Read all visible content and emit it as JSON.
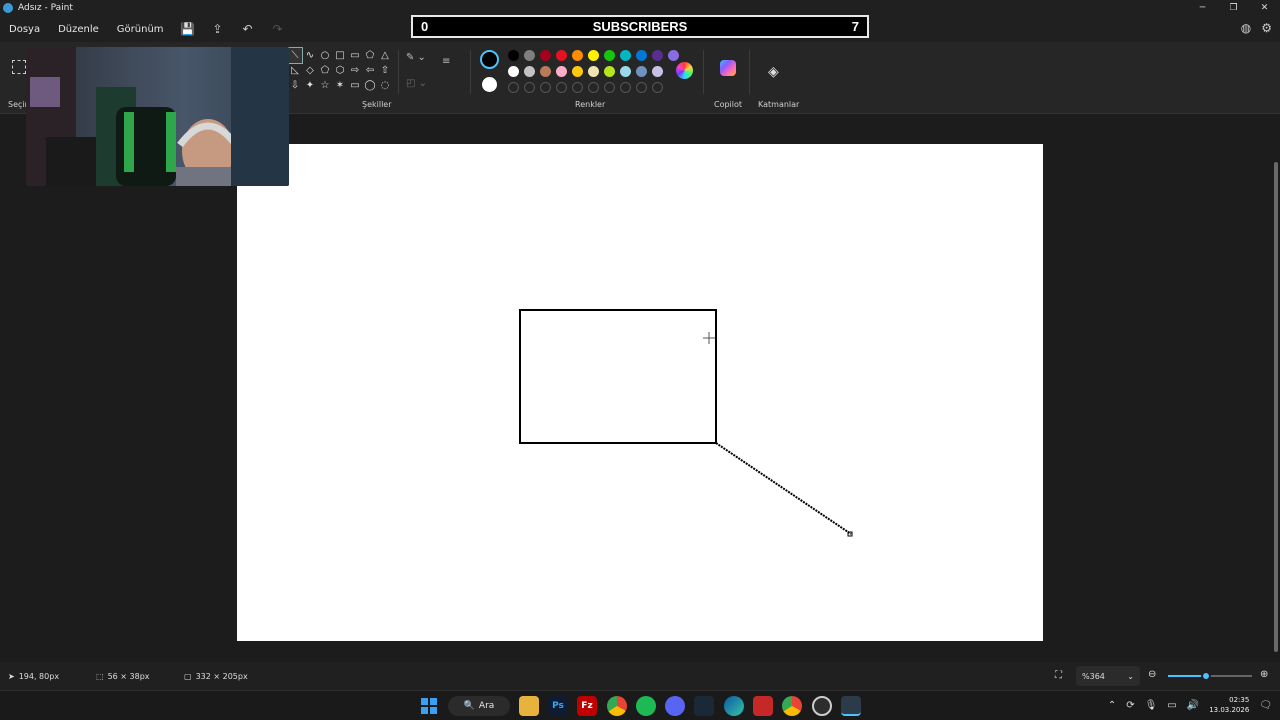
{
  "window": {
    "title": "Adsız - Paint",
    "minimize": "─",
    "maximize": "❐",
    "close": "✕"
  },
  "menu": {
    "file": "Dosya",
    "edit": "Düzenle",
    "view": "Görünüm"
  },
  "toolbar_icons": {
    "save": "💾",
    "share": "⇪",
    "undo": "↶",
    "redo": "↷",
    "account": "◍",
    "settings": "⚙"
  },
  "overlay": {
    "left_count": "0",
    "label": "SUBSCRIBERS",
    "right_count": "7"
  },
  "ribbon": {
    "selection_label": "Seçim",
    "shapes_label": "Şekiller",
    "colors_label": "Renkler",
    "copilot_label": "Copilot",
    "layers_label": "Katmanlar",
    "shapes": [
      "⟍",
      "∿",
      "○",
      "□",
      "▭",
      "⬠",
      "△",
      "◺",
      "◇",
      "⬠",
      "⬡",
      "⇨",
      "⇦",
      "⇧",
      "⇩",
      "✦",
      "☆",
      "✶",
      "▭",
      "◯",
      "◌"
    ],
    "primary_color": "#000000",
    "secondary_color": "#ffffff",
    "palette_row1": [
      "#000000",
      "#7f7f7f",
      "#a8001c",
      "#e81123",
      "#ff8c00",
      "#fff100",
      "#16c60c",
      "#00b7c3",
      "#0078d4",
      "#5c2d91",
      "#886ce4"
    ],
    "palette_row2": [
      "#ffffff",
      "#c3c3c3",
      "#b97a57",
      "#ffaec9",
      "#ffc90e",
      "#efe4b0",
      "#b5e61d",
      "#99d9ea",
      "#7092be",
      "#c8bfe7"
    ],
    "palette_row3_empty": 10
  },
  "status": {
    "cursor_position": "194, 80px",
    "selection_size": "56 × 38px",
    "canvas_size": "332 × 205px",
    "zoom": "%364",
    "zoom_level": 0.45
  },
  "taskbar": {
    "search_label": "Ara",
    "time": "02:35",
    "date": "13.03.2026"
  },
  "colors": {
    "accent": "#4cc2ff",
    "background": "#1c1c1c"
  }
}
